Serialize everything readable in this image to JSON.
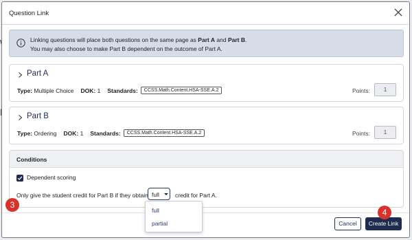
{
  "modal": {
    "title": "Question Link"
  },
  "info": {
    "line1_pre": "Linking questions will place both questions on the same page as ",
    "part_a": "Part A",
    "and": " and ",
    "part_b": "Part B",
    "period": ".",
    "line2": "You may also choose to make Part B dependent on the outcome of Part A."
  },
  "parts": [
    {
      "title": "Part A",
      "type_label": "Type:",
      "type": "Multiple Choice",
      "dok_label": "DOK:",
      "dok": "1",
      "standards_label": "Standards:",
      "standard": "CCSS.Math.Content.HSA-SSE.A.2",
      "points_label": "Points:",
      "points": "1"
    },
    {
      "title": "Part B",
      "type_label": "Type:",
      "type": "Ordering",
      "dok_label": "DOK:",
      "dok": "1",
      "standards_label": "Standards:",
      "standard": "CCSS.Math.Content.HSA-SSE.A.2",
      "points_label": "Points:",
      "points": "1"
    }
  ],
  "conditions": {
    "title": "Conditions",
    "dependent_label": "Dependent scoring",
    "sentence_pre": "Only give the student credit for Part B if they obtain",
    "selected": "full",
    "sentence_post": "credit for Part A.",
    "options": [
      "full",
      "partial"
    ]
  },
  "footer": {
    "cancel": "Cancel",
    "create": "Create Link"
  },
  "badges": {
    "three": "3",
    "four": "4"
  },
  "colors": {
    "primary": "#1f2b4f",
    "badge": "#d9322a",
    "banner": "#d6dde8"
  }
}
